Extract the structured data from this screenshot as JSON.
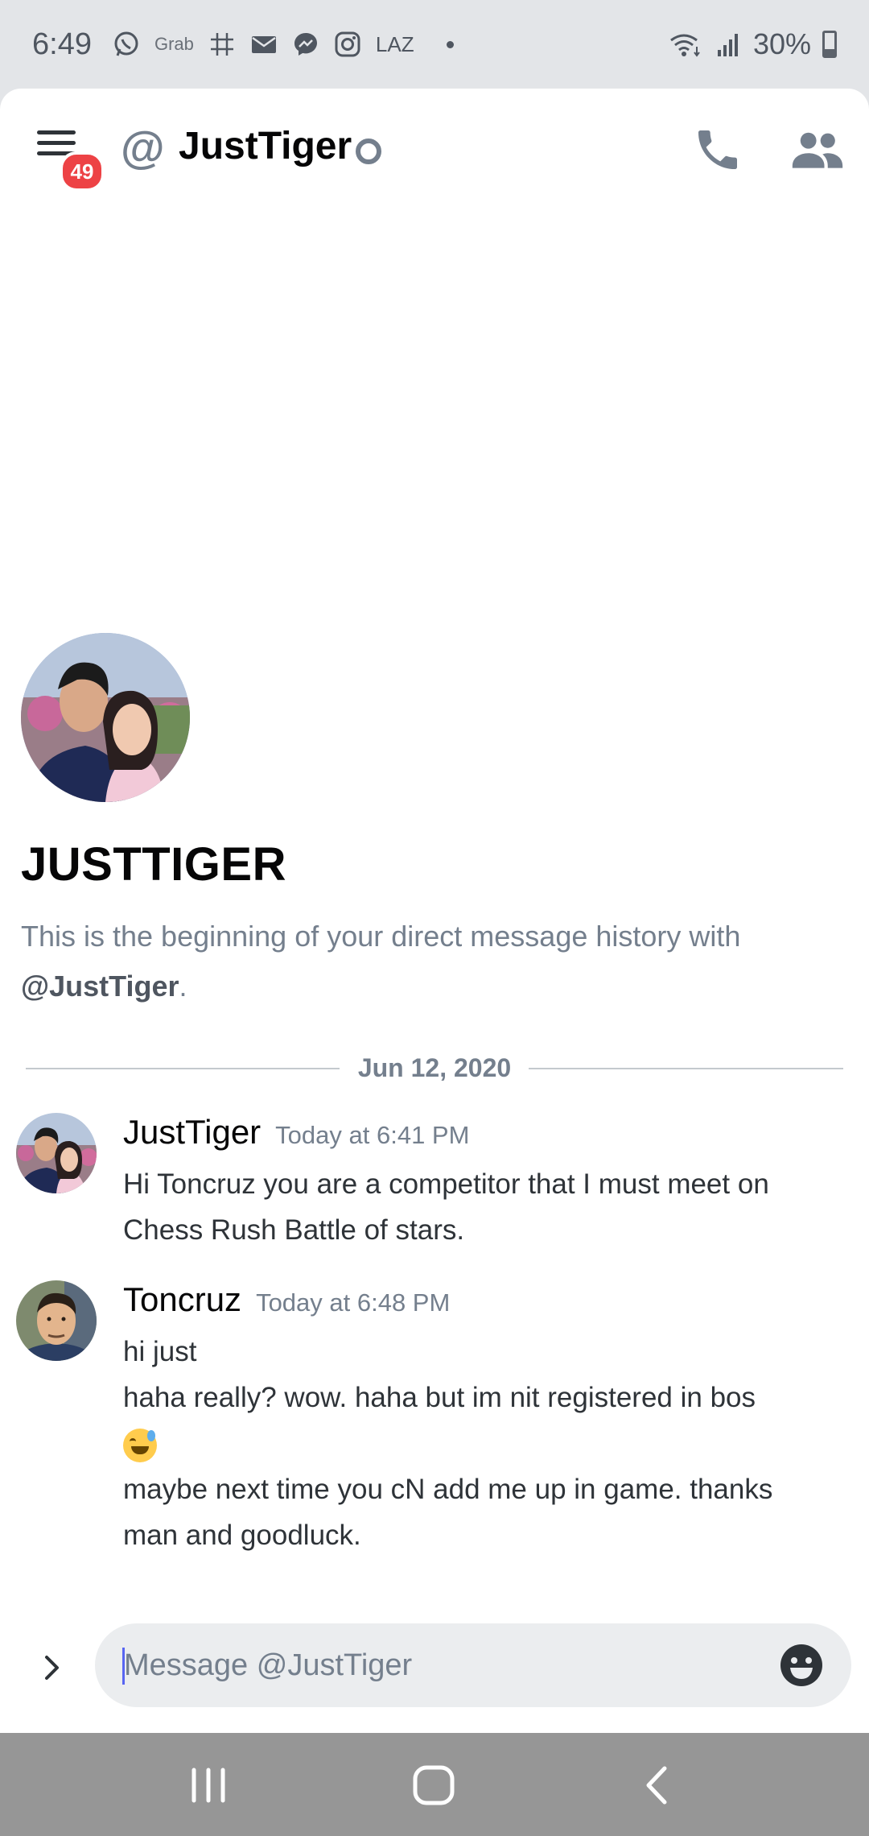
{
  "status_bar": {
    "time": "6:49",
    "grab_label": "Grab",
    "laz_label": "LAZ",
    "battery": "30%",
    "icons": [
      "whatsapp-icon",
      "grab-icon",
      "hash-icon",
      "mail-icon",
      "messenger-icon",
      "instagram-icon",
      "lazada-icon",
      "dot-icon",
      "wifi-icon",
      "signal-icon",
      "battery-icon"
    ]
  },
  "header": {
    "unread_badge": "49",
    "at_symbol": "@",
    "channel_name": "JustTiger",
    "presence": "offline",
    "colors": {
      "badge": "#ed4245",
      "muted": "#747f8d"
    }
  },
  "intro": {
    "title": "JUSTTIGER",
    "text_prefix": "This is the beginning of your direct message history with",
    "mention": "@JustTiger",
    "text_suffix": "."
  },
  "divider": {
    "date": "Jun 12, 2020"
  },
  "messages": [
    {
      "author": "JustTiger",
      "time": "Today at 6:41 PM",
      "lines": [
        "Hi Toncruz you are a competitor that I must meet on",
        "Chess Rush Battle of stars."
      ]
    },
    {
      "author": "Toncruz",
      "time": "Today at 6:48 PM",
      "lines": [
        "hi just",
        "haha really? wow. haha but im nit registered in bos",
        "maybe next time you cN add me up in game. thanks",
        "man and goodluck."
      ],
      "emoji": "grinning-sweat-emoji"
    }
  ],
  "composer": {
    "placeholder": "Message @JustTiger",
    "value": ""
  },
  "accent": "#5865f2"
}
